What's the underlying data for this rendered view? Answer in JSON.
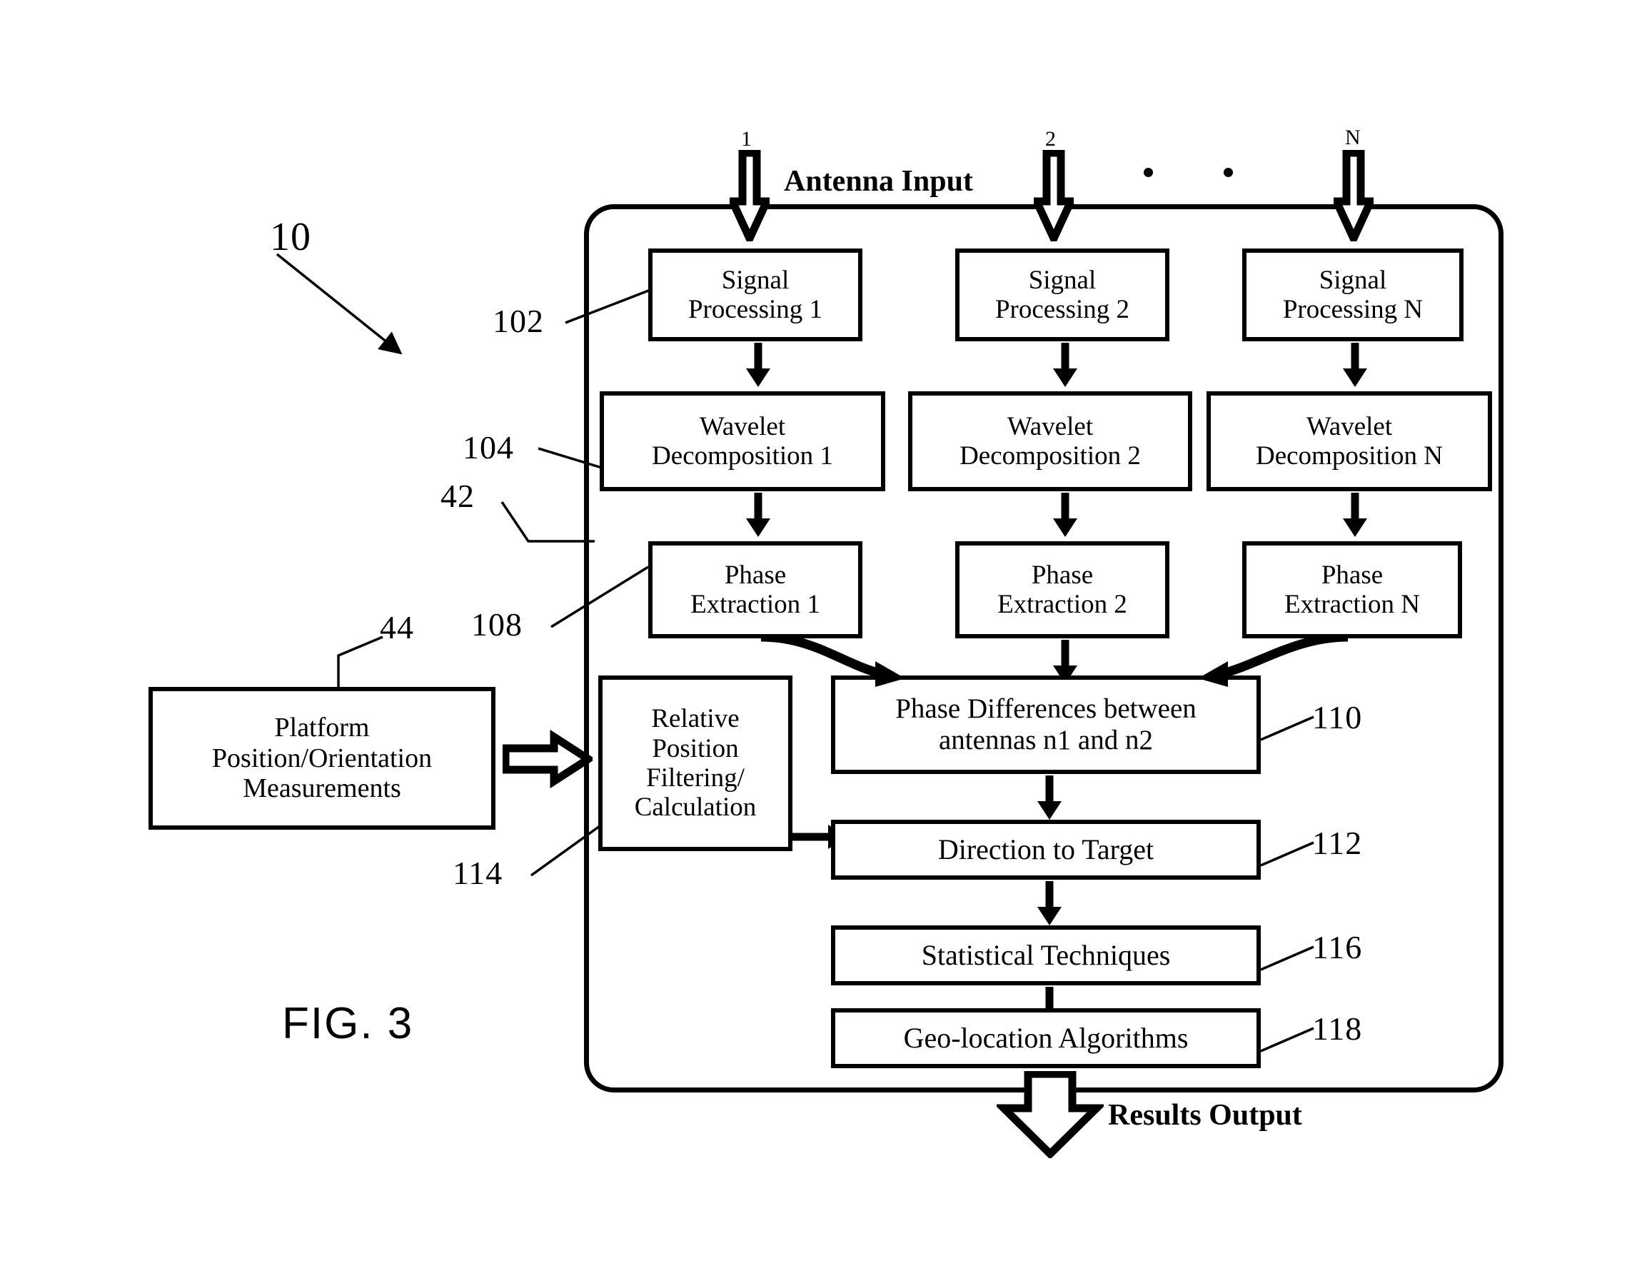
{
  "figure": {
    "label": "FIG. 3",
    "system_ref": "10",
    "container_ref": "42"
  },
  "antenna_input": {
    "label": "Antenna Input",
    "channel_indices": [
      "1",
      "2",
      "N"
    ],
    "ellipsis": "• •"
  },
  "results_output": {
    "label": "Results Output"
  },
  "columns": [
    {
      "signal_processing": {
        "line1": "Signal",
        "line2": "Processing 1"
      },
      "wavelet": {
        "line1": "Wavelet",
        "line2": "Decomposition 1"
      },
      "phase_extraction": {
        "line1": "Phase",
        "line2": "Extraction 1"
      }
    },
    {
      "signal_processing": {
        "line1": "Signal",
        "line2": "Processing 2"
      },
      "wavelet": {
        "line1": "Wavelet",
        "line2": "Decomposition 2"
      },
      "phase_extraction": {
        "line1": "Phase",
        "line2": "Extraction 2"
      }
    },
    {
      "signal_processing": {
        "line1": "Signal",
        "line2": "Processing N"
      },
      "wavelet": {
        "line1": "Wavelet",
        "line2": "Decomposition N"
      },
      "phase_extraction": {
        "line1": "Phase",
        "line2": "Extraction N"
      }
    }
  ],
  "refs": {
    "signal_processing": "102",
    "wavelet": "104",
    "phase_extraction": "108",
    "phase_differences": "110",
    "direction_to_target": "112",
    "statistical_techniques": "116",
    "geolocation_algorithms": "118",
    "relative_position": "114",
    "platform_measurements": "44"
  },
  "blocks": {
    "platform": {
      "line1": "Platform",
      "line2": "Position/Orientation",
      "line3": "Measurements"
    },
    "relative_position": {
      "line1": "Relative",
      "line2": "Position",
      "line3": "Filtering/",
      "line4": "Calculation"
    },
    "phase_differences": {
      "line1": "Phase Differences between",
      "line2": "antennas n1 and n2"
    },
    "direction_to_target": {
      "line1": "Direction to Target"
    },
    "statistical_techniques": {
      "line1": "Statistical Techniques"
    },
    "geolocation_algorithms": {
      "line1": "Geo-location Algorithms"
    }
  },
  "colors": {
    "ink": "#000000",
    "paper": "#ffffff"
  }
}
